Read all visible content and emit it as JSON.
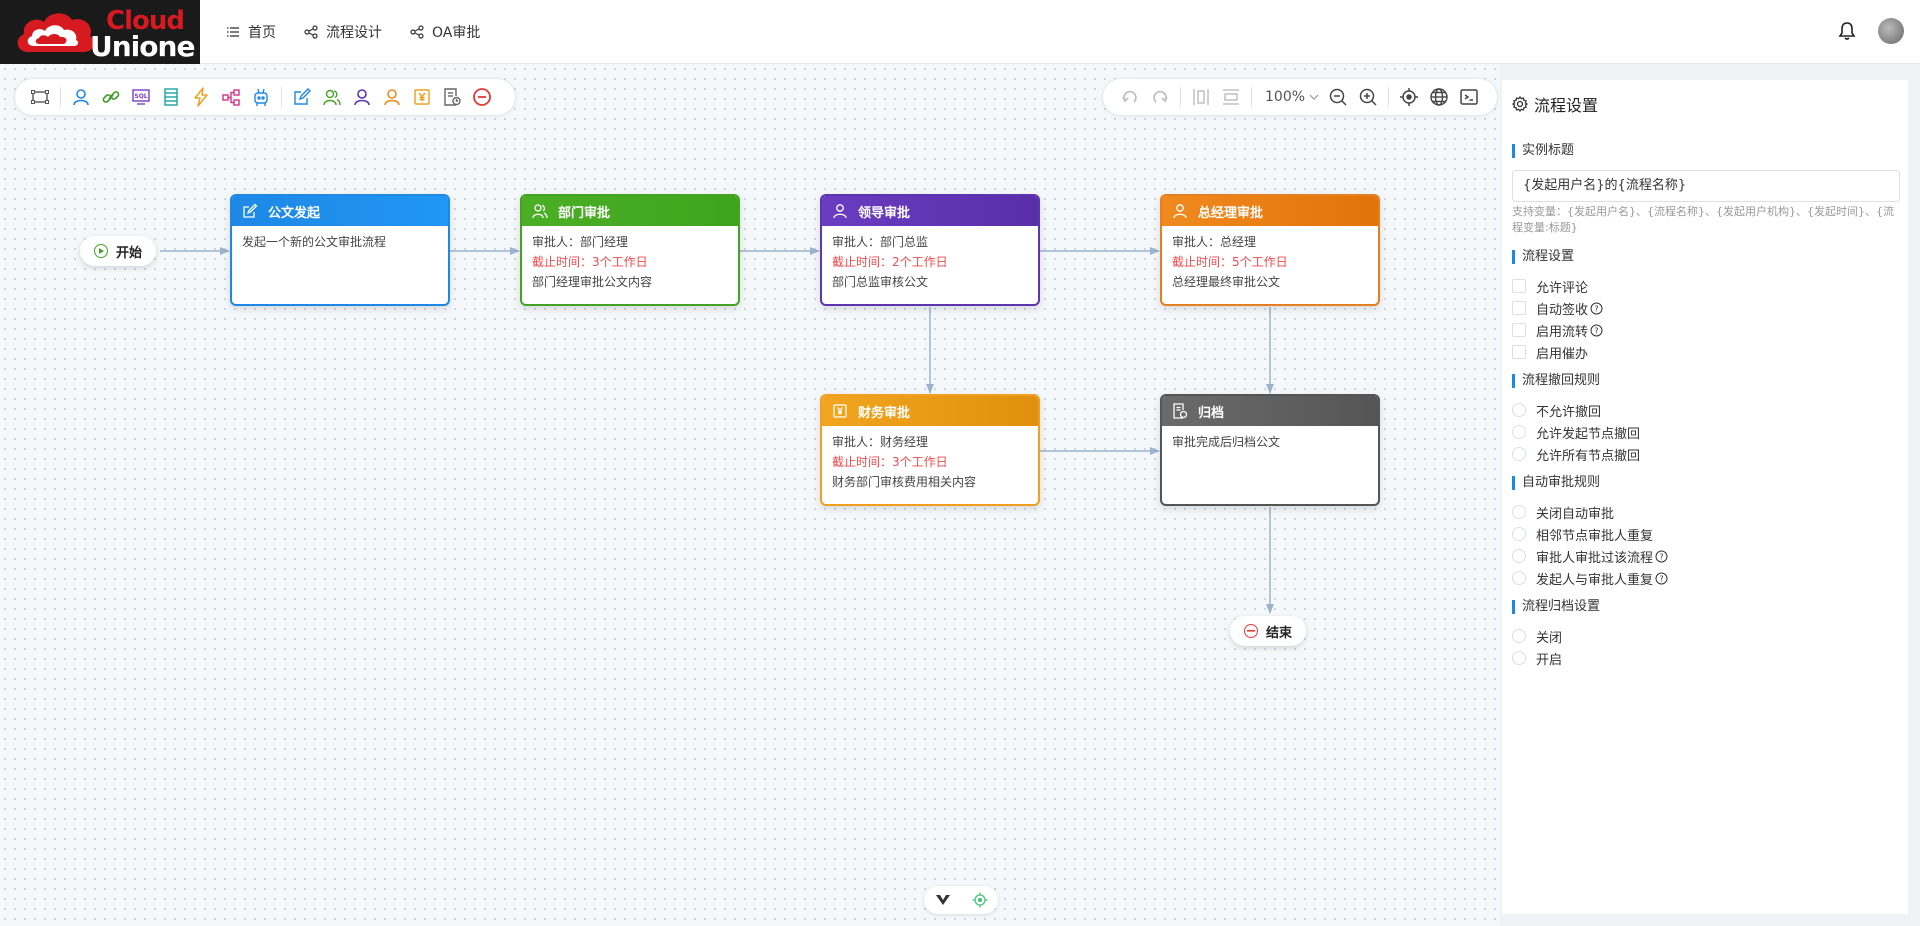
{
  "brand": {
    "line1": "Cloud",
    "line2": "Unione"
  },
  "nav": [
    {
      "label": "首页",
      "icon": "list-icon"
    },
    {
      "label": "流程设计",
      "icon": "flow-icon"
    },
    {
      "label": "OA审批",
      "icon": "flow-icon"
    }
  ],
  "toolbar": {
    "zoom": "100%",
    "left_tools": [
      "select-area-icon",
      "user-icon",
      "link-icon",
      "sql-icon",
      "form-icon",
      "lightning-icon",
      "subflow-icon",
      "robot-icon",
      "edit-icon",
      "multi-user-icon",
      "purple-user-icon",
      "orange-user-icon",
      "finance-icon",
      "archive-icon",
      "end-icon"
    ],
    "right_tools": [
      "undo-icon",
      "redo-icon",
      "align-vertical-icon",
      "align-horizontal-icon",
      "zoom-out-icon",
      "zoom-in-icon",
      "locate-icon",
      "globe-icon",
      "terminal-icon"
    ]
  },
  "flow": {
    "start": "开始",
    "end": "结束",
    "nodes": {
      "initiate": {
        "title": "公文发起",
        "lines": [
          "发起一个新的公文审批流程"
        ]
      },
      "dept": {
        "title": "部门审批",
        "approver": "审批人：部门经理",
        "deadline": "截止时间：3个工作日",
        "desc": "部门经理审批公文内容"
      },
      "leader": {
        "title": "领导审批",
        "approver": "审批人：部门总监",
        "deadline": "截止时间：2个工作日",
        "desc": "部门总监审核公文"
      },
      "gm": {
        "title": "总经理审批",
        "approver": "审批人：总经理",
        "deadline": "截止时间：5个工作日",
        "desc": "总经理最终审批公文"
      },
      "finance": {
        "title": "财务审批",
        "approver": "审批人：财务经理",
        "deadline": "截止时间：3个工作日",
        "desc": "财务部门审核费用相关内容"
      },
      "archive": {
        "title": "归档",
        "desc": "审批完成后归档公文"
      }
    },
    "colors": {
      "blue": "#1e88e5",
      "green": "#43a324",
      "purple": "#5e35b1",
      "orange": "#e67e22",
      "amber": "#f0a020",
      "gray": "#555555",
      "edge": "#9bb3cc"
    }
  },
  "panel": {
    "title": "流程设置",
    "instance_title_label": "实例标题",
    "instance_title_value": "{发起用户名}的{流程名称}",
    "instance_title_hint": "支持变量：{发起用户名}、{流程名称}、{发起用户机构}、{发起时间}、{流程变量:标题}",
    "flow_settings_label": "流程设置",
    "flow_settings": [
      {
        "label": "允许评论",
        "help": false
      },
      {
        "label": "自动签收",
        "help": true
      },
      {
        "label": "启用流转",
        "help": true
      },
      {
        "label": "启用催办",
        "help": false
      }
    ],
    "withdraw_label": "流程撤回规则",
    "withdraw": [
      "不允许撤回",
      "允许发起节点撤回",
      "允许所有节点撤回"
    ],
    "auto_label": "自动审批规则",
    "auto": [
      {
        "label": "关闭自动审批",
        "help": false
      },
      {
        "label": "相邻节点审批人重复",
        "help": false
      },
      {
        "label": "审批人审批过该流程",
        "help": true
      },
      {
        "label": "发起人与审批人重复",
        "help": true
      }
    ],
    "archive_label": "流程归档设置",
    "archive": [
      "关闭",
      "开启"
    ]
  }
}
